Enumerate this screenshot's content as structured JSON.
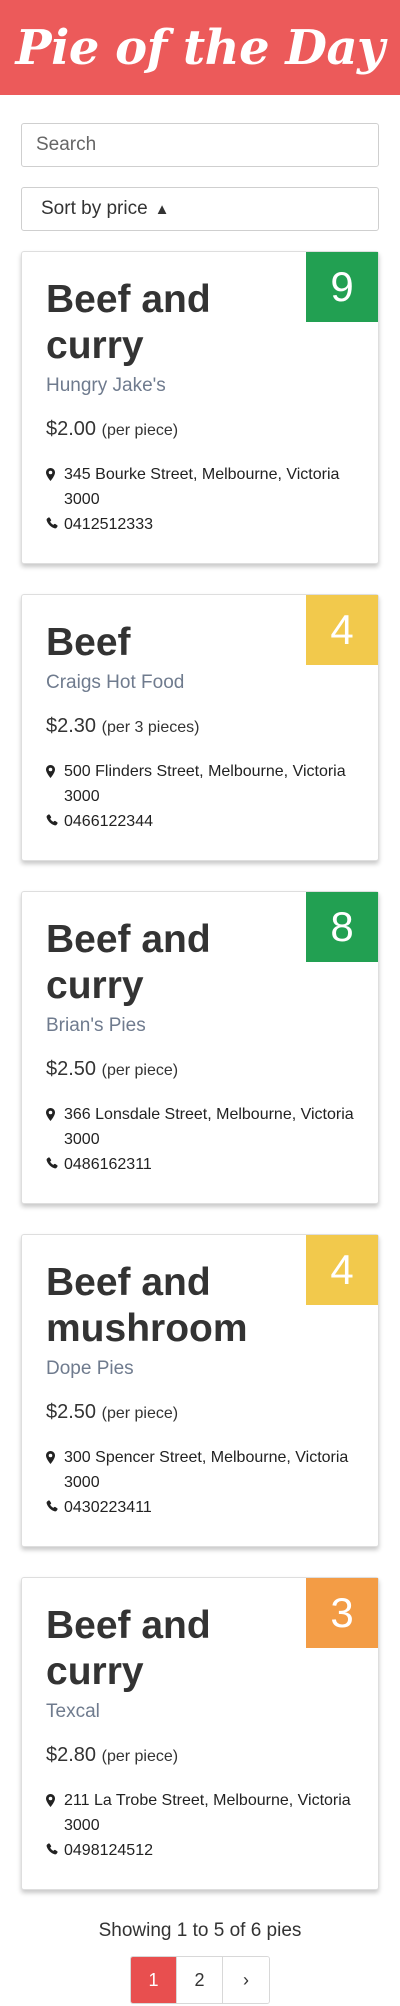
{
  "header": {
    "title": "Pie of the Day",
    "color": "#ec5a5a"
  },
  "controls": {
    "search_placeholder": "Search",
    "search_value": "",
    "sort_label": "Sort by price",
    "sort_arrow": "▲"
  },
  "cards": [
    {
      "name": "Beef and curry",
      "shop": "Hungry Jake's",
      "price": "$2.00",
      "unit": "(per piece)",
      "address": "345 Bourke Street, Melbourne, Victoria 3000",
      "phone": "0412512333",
      "rating": "9",
      "rating_color": "#22a052"
    },
    {
      "name": "Beef",
      "shop": "Craigs Hot Food",
      "price": "$2.30",
      "unit": "(per 3 pieces)",
      "address": "500 Flinders Street, Melbourne, Victoria 3000",
      "phone": "0466122344",
      "rating": "4",
      "rating_color": "#f2c94c"
    },
    {
      "name": "Beef and curry",
      "shop": "Brian's Pies",
      "price": "$2.50",
      "unit": "(per piece)",
      "address": "366 Lonsdale Street, Melbourne, Victoria 3000",
      "phone": "0486162311",
      "rating": "8",
      "rating_color": "#22a052"
    },
    {
      "name": "Beef and mushroom",
      "shop": "Dope Pies",
      "price": "$2.50",
      "unit": "(per piece)",
      "address": "300 Spencer Street, Melbourne, Victoria 3000",
      "phone": "0430223411",
      "rating": "4",
      "rating_color": "#f2c94c"
    },
    {
      "name": "Beef and curry",
      "shop": "Texcal",
      "price": "$2.80",
      "unit": "(per piece)",
      "address": "211 La Trobe Street, Melbourne, Victoria 3000",
      "phone": "0498124512",
      "rating": "3",
      "rating_color": "#f39c45"
    }
  ],
  "footer": {
    "showing_text": "Showing 1 to 5 of 6 pies",
    "pages": [
      "1",
      "2"
    ],
    "active_page": "1",
    "next_label": "›"
  }
}
